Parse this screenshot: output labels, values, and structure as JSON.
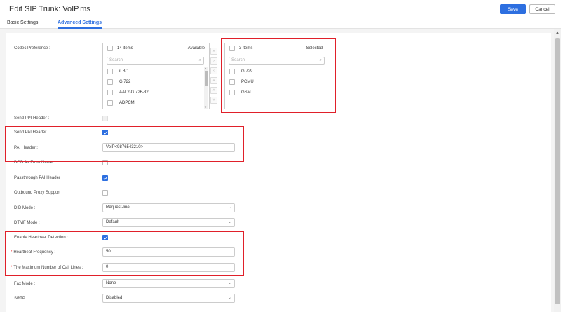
{
  "header": {
    "title": "Edit SIP Trunk: VoIP.ms",
    "save_label": "Save",
    "cancel_label": "Cancel"
  },
  "tabs": [
    {
      "label": "Basic Settings",
      "active": false
    },
    {
      "label": "Advanced Settings",
      "active": true
    }
  ],
  "codec": {
    "label": "Codec Preference :",
    "available": {
      "count": "14 items",
      "tag": "Available",
      "search_placeholder": "Search",
      "items": [
        "iLBC",
        "G.722",
        "AAL2-G.726-32",
        "ADPCM"
      ]
    },
    "selected": {
      "count": "3 items",
      "tag": "Selected",
      "search_placeholder": "Search",
      "items": [
        "G.729",
        "PCMU",
        "GSM"
      ]
    }
  },
  "fields": {
    "send_ppi_header": {
      "label": "Send PPI Header :",
      "checked": false
    },
    "send_pai_header": {
      "label": "Send PAI Header :",
      "checked": true
    },
    "pai_header": {
      "label": "PAI Header :",
      "value": "VoIP<9876543210>"
    },
    "dod_as_from_name": {
      "label": "DOD As From Name :",
      "checked": false
    },
    "passthrough_pai_header": {
      "label": "Passthrough PAI Header :",
      "checked": true
    },
    "outbound_proxy_support": {
      "label": "Outbound Proxy Support :",
      "checked": false
    },
    "did_mode": {
      "label": "DID Mode :",
      "value": "Request-line"
    },
    "dtmf_mode": {
      "label": "DTMF Mode :",
      "value": "Default"
    },
    "enable_heartbeat": {
      "label": "Enable Heartbeat Detection :",
      "checked": true
    },
    "heartbeat_frequency": {
      "label": "Heartbeat Frequency :",
      "value": "50",
      "required": true
    },
    "max_call_lines": {
      "label": "The Maximum Number of Call Lines :",
      "value": "0",
      "required": true
    },
    "fax_mode": {
      "label": "Fax Mode :",
      "value": "None"
    },
    "srtp": {
      "label": "SRTP :",
      "value": "Disabled"
    }
  },
  "colors": {
    "accent": "#2d6fe0",
    "highlight_box": "#e0202a"
  },
  "icons": {
    "search": "search-icon",
    "chevron": "chevron-down-icon"
  }
}
